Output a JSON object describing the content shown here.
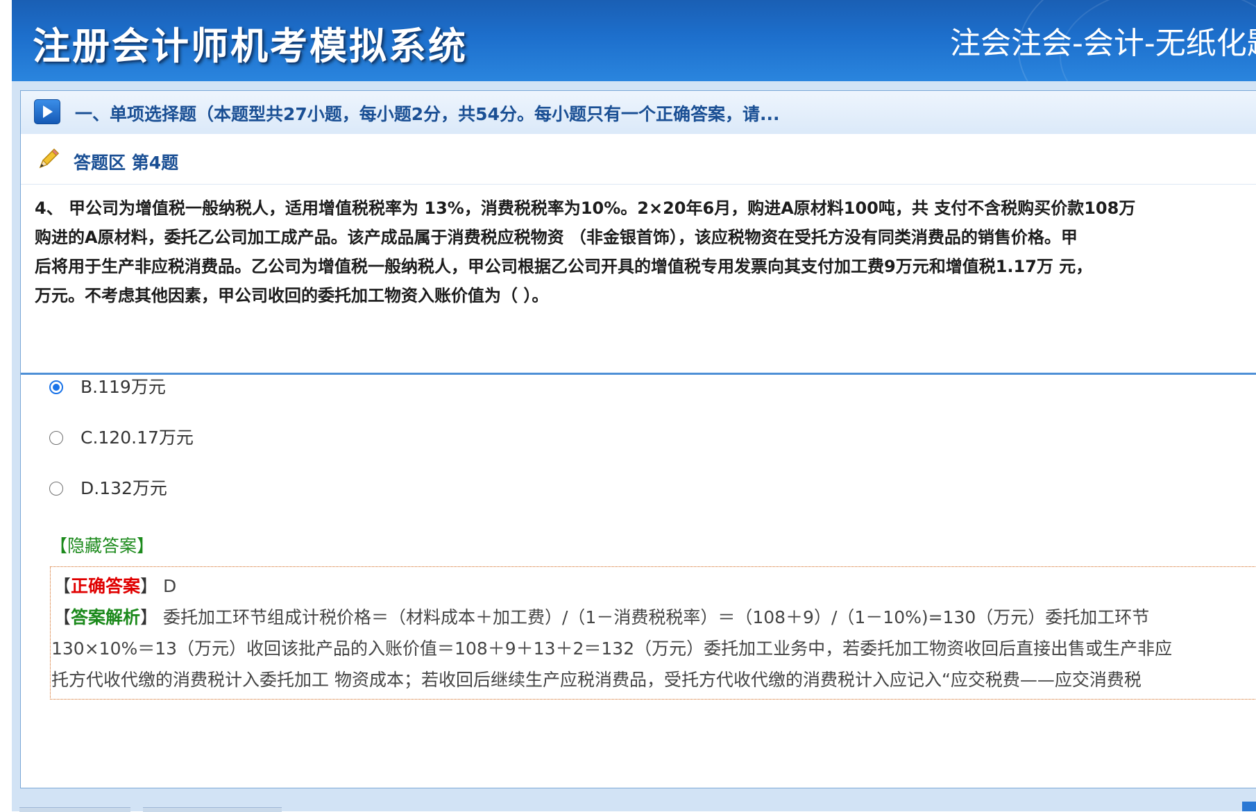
{
  "header": {
    "app_title": "注册会计师机考模拟系统",
    "exam_name": "注会注会-会计-无纸化题"
  },
  "section": {
    "title": "一、单项选择题（本题型共27小题，每小题2分，共54分。每小题只有一个正确答案，请..."
  },
  "answer_area": {
    "title": "答题区 第4题"
  },
  "question": {
    "lines": [
      "4、 甲公司为增值税一般纳税人，适用增值税税率为 13%，消费税税率为10%。2×20年6月，购进A原材料100吨，共 支付不含税购买价款108万",
      "购进的A原材料，委托乙公司加工成产品。该产成品属于消费税应税物资 （非金银首饰），该应税物资在受托方没有同类消费品的销售价格。甲",
      "后将用于生产非应税消费品。乙公司为增值税一般纳税人，甲公司根据乙公司开具的增值税专用发票向其支付加工费9万元和增值税1.17万 元，",
      "万元。不考虑其他因素，甲公司收回的委托加工物资入账价值为（ ）。"
    ]
  },
  "options": [
    {
      "label": "B.119万元",
      "selected": true
    },
    {
      "label": "C.120.17万元",
      "selected": false
    },
    {
      "label": "D.132万元",
      "selected": false
    }
  ],
  "hide_answer_label": "【隐藏答案】",
  "answer": {
    "correct_label": "正确答案",
    "correct_value": "D",
    "analysis_label": "答案解析",
    "analysis_lines": [
      "委托加工环节组成计税价格＝（材料成本＋加工费）/（1－消费税税率）＝（108＋9）/（1－10%)=130（万元）委托加工环节",
      "130×10%＝13（万元）收回该批产品的入账价值＝108＋9＋13＋2＝132（万元）委托加工业务中，若委托加工物资收回后直接出售或生产非应",
      "托方代收代缴的消费税计入委托加工 物资成本；若收回后继续生产应税消费品，受托方代收代缴的消费税计入应记入“应交税费——应交消费税"
    ]
  },
  "colors": {
    "header_blue": "#1d6fcc",
    "title_blue": "#1a4f94",
    "correct_red": "#e00000",
    "analysis_green": "#1c8a1c",
    "radio_blue": "#1a73e8"
  }
}
